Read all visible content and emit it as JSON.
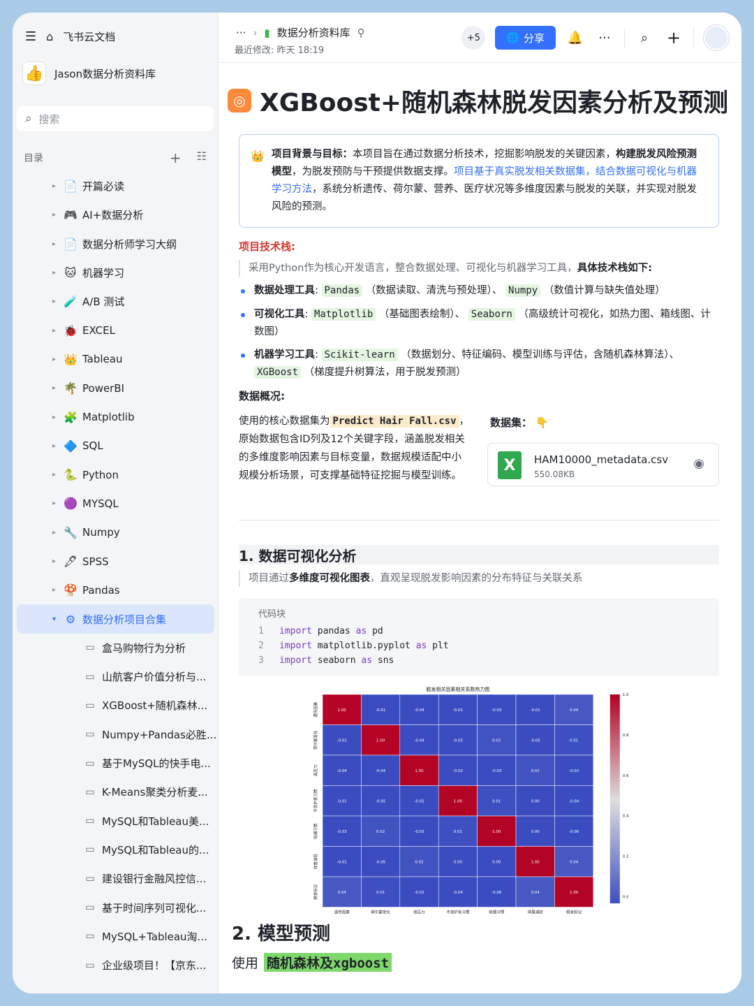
{
  "sidebar": {
    "home": "飞书云文档",
    "workspace": "Jason数据分析资料库",
    "search_placeholder": "搜索",
    "toc_label": "目录",
    "items": [
      {
        "label": "开篇必读",
        "icon": "📄"
      },
      {
        "label": "AI+数据分析",
        "icon": "🎮"
      },
      {
        "label": "数据分析师学习大纲",
        "icon": "📄"
      },
      {
        "label": "机器学习",
        "icon": "🐱"
      },
      {
        "label": "A/B 测试",
        "icon": "🧪"
      },
      {
        "label": "EXCEL",
        "icon": "🐞"
      },
      {
        "label": "Tableau",
        "icon": "👑"
      },
      {
        "label": "PowerBI",
        "icon": "🌴"
      },
      {
        "label": "Matplotlib",
        "icon": "🧩"
      },
      {
        "label": "SQL",
        "icon": "🔷"
      },
      {
        "label": "Python",
        "icon": "🐍"
      },
      {
        "label": "MYSQL",
        "icon": "🟣"
      },
      {
        "label": "Numpy",
        "icon": "🔧"
      },
      {
        "label": "SPSS",
        "icon": "🖋"
      },
      {
        "label": "Pandas",
        "icon": "🍄"
      }
    ],
    "active_item": {
      "label": "数据分析项目合集",
      "icon": "⚙"
    },
    "sub_items": [
      "盒马购物行为分析",
      "山航客户价值分析与...",
      "XGBoost+随机森林...",
      "Numpy+Pandas必胜...",
      "基于MySQL的快手电...",
      "K-Means聚类分析麦...",
      "MySQL和Tableau美...",
      "MySQL和Tableau的...",
      "建设银行金融风控信...",
      "基于时间序列可视化...",
      "MySQL+Tableau淘...",
      "企业级项目！【京东..."
    ]
  },
  "header": {
    "breadcrumb": "数据分析资料库",
    "modified": "最近修改: 昨天 18:19",
    "collaborators": "+5",
    "share": "分享"
  },
  "doc": {
    "title": "XGBoost+随机森林脱发因素分析及预测",
    "callout": {
      "b1": "项目背景与目标：",
      "t1": "本项目旨在通过数据分析技术，挖掘影响脱发的关键因素，",
      "b2": "构建脱发风险预测模型",
      "t2": "，为脱发预防与干预提供数据支撑。",
      "link": "项目基于真实脱发相关数据集，结合数据可视化与机器学习方法",
      "t3": "，系统分析遗传、荷尔蒙、营养、医疗状况等多维度因素与脱发的关联，并实现对脱发风险的预测。"
    },
    "tech_heading": "项目技术栈:",
    "tech_quote": "采用Python作为核心开发语言，整合数据处理、可视化与机器学习工具，",
    "tech_quote_b": "具体技术栈如下:",
    "b1": {
      "label": "数据处理工具",
      "c1": "Pandas",
      "d1": "（数据读取、清洗与预处理）、",
      "c2": "Numpy",
      "d2": "（数值计算与缺失值处理）"
    },
    "b2": {
      "label": "可视化工具",
      "c1": "Matplotlib",
      "d1": "（基础图表绘制）、",
      "c2": "Seaborn",
      "d2": "（高级统计可视化，如热力图、箱线图、计数图）"
    },
    "b3": {
      "label": "机器学习工具",
      "c1": "Scikit-learn",
      "d1": "（数据划分、特征编码、模型训练与评估，含随机森林算法）、",
      "c2": "XGBoost",
      "d2": "（梯度提升树算法，用于脱发预测）"
    },
    "data_heading": "数据概况:",
    "data_p1": "使用的核心数据集为",
    "data_file": "Predict Hair Fall.csv",
    "data_p2": "，原始数据包含ID列及12个关键字段，涵盖脱发相关的多维度影响因素与目标变量，数据规模适配中小规模分析场景，可支撑基础特征挖掘与模型训练。",
    "dataset_label": "数据集：",
    "file": {
      "name": "HAM10000_metadata.csv",
      "size": "550.08KB"
    },
    "s1_title": "1. 数据可视化分析",
    "s1_quote_a": "项目通过",
    "s1_quote_b": "多维度可视化图表",
    "s1_quote_c": "，直观呈现脱发影响因素的分布特征与关联关系",
    "code_title": "代码块",
    "code": [
      {
        "n": "1",
        "kw": "import",
        "rest": "pandas",
        "as": "as",
        "alias": "pd"
      },
      {
        "n": "2",
        "kw": "import",
        "rest": "matplotlib.pyplot",
        "as": "as",
        "alias": "plt"
      },
      {
        "n": "3",
        "kw": "import",
        "rest": "seaborn",
        "as": "as",
        "alias": "sns"
      }
    ],
    "s2_title": "2. 模型预测",
    "s2_use": "使用",
    "s2_hl": "随机森林及xgboost"
  },
  "chart_data": {
    "type": "heatmap",
    "title": "脱发相关因素相关系数热力图",
    "labels": [
      "遗传因素",
      "荷尔蒙变化",
      "高压力",
      "不良护发习惯",
      "吸烟习惯",
      "体重减轻",
      "脱发标记"
    ],
    "values": [
      [
        1.0,
        -0.01,
        -0.04,
        -0.01,
        -0.03,
        -0.01,
        0.04
      ],
      [
        -0.01,
        1.0,
        -0.04,
        -0.05,
        0.02,
        -0.05,
        0.01
      ],
      [
        -0.04,
        -0.04,
        1.0,
        -0.02,
        -0.03,
        0.02,
        -0.02
      ],
      [
        -0.01,
        -0.05,
        -0.02,
        1.0,
        0.01,
        -0.0,
        -0.04
      ],
      [
        -0.03,
        0.02,
        -0.03,
        0.01,
        1.0,
        -0.0,
        -0.06
      ],
      [
        -0.01,
        -0.05,
        0.02,
        -0.0,
        -0.0,
        1.0,
        0.04
      ],
      [
        0.04,
        0.01,
        -0.02,
        -0.04,
        -0.06,
        0.04,
        1.0
      ]
    ],
    "colorbar_ticks": [
      "1.0",
      "0.8",
      "0.6",
      "0.4",
      "0.2",
      "0.0"
    ],
    "colorscale": "coolwarm"
  }
}
